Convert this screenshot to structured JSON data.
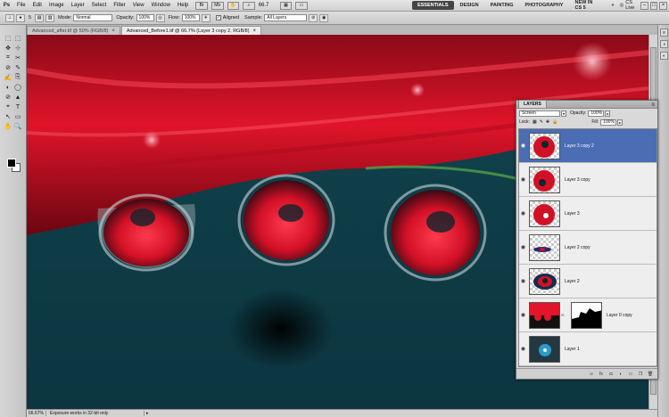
{
  "app": {
    "logo": "Ps",
    "menu": [
      "File",
      "Edit",
      "Image",
      "Layer",
      "Select",
      "Filter",
      "View",
      "Window",
      "Help"
    ],
    "zoom_display": "66.7",
    "workspaces": [
      "ESSENTIALS",
      "DESIGN",
      "PAINTING",
      "PHOTOGRAPHY",
      "NEW IN CS 5"
    ],
    "active_workspace": "ESSENTIALS",
    "cs_live": "CS Live",
    "window_buttons": [
      "–",
      "□",
      "×"
    ]
  },
  "options": {
    "brush_size": "5",
    "mode_label": "Mode:",
    "mode_value": "Normal",
    "opacity_label": "Opacity:",
    "opacity_value": "100%",
    "flow_label": "Flow:",
    "flow_value": "100%",
    "aligned_label": "Aligned",
    "aligned_checked": "✓",
    "sample_label": "Sample:",
    "sample_value": "All Layers"
  },
  "tabs": [
    {
      "label": "Advanced_after.tif @ 50% (RGB/8)",
      "active": false
    },
    {
      "label": "Advanced_Before1.tif @ 66.7% (Layer 3 copy 2, RGB/8)",
      "active": true
    }
  ],
  "tools": [
    "⬚",
    "⬚",
    "✥",
    "⊹",
    "⌗",
    "✂",
    "⊘",
    "✎",
    "✍",
    "⎘",
    "◐",
    "◯",
    "⊘",
    "▲",
    "⌖",
    "T",
    "↖",
    "▭",
    "✋",
    "🔍"
  ],
  "status": {
    "zoom": "66.67%",
    "info": "Exposure works in 32-bit only"
  },
  "layers_panel": {
    "tab_label": "LAYERS",
    "blend_mode": "Screen",
    "opacity_label": "Opacity:",
    "opacity_value": "100%",
    "lock_label": "Lock:",
    "fill_label": "Fill:",
    "fill_value": "100%",
    "layers": [
      {
        "name": "Layer 3 copy 2",
        "thumb": "red-drop",
        "selected": true,
        "mask": false
      },
      {
        "name": "Layer 3 copy",
        "thumb": "red-drop",
        "selected": false,
        "mask": false
      },
      {
        "name": "Layer 3",
        "thumb": "red-drop",
        "selected": false,
        "mask": false
      },
      {
        "name": "Layer 2 copy",
        "thumb": "eye-strip",
        "selected": false,
        "mask": false
      },
      {
        "name": "Layer 2",
        "thumb": "eye-drop",
        "selected": false,
        "mask": false
      },
      {
        "name": "Layer 0 copy",
        "thumb": "petal",
        "selected": false,
        "mask": true
      },
      {
        "name": "Layer 1",
        "thumb": "blue-flower",
        "selected": false,
        "mask": false
      }
    ],
    "bottom_icons": [
      "link-icon",
      "fx-icon",
      "mask-icon",
      "adjustment-icon",
      "folder-icon",
      "new-layer-icon",
      "trash-icon"
    ]
  }
}
